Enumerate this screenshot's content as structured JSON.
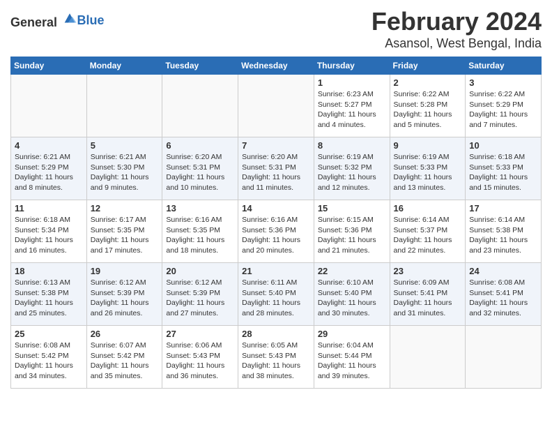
{
  "logo": {
    "general": "General",
    "blue": "Blue"
  },
  "title": "February 2024",
  "subtitle": "Asansol, West Bengal, India",
  "weekdays": [
    "Sunday",
    "Monday",
    "Tuesday",
    "Wednesday",
    "Thursday",
    "Friday",
    "Saturday"
  ],
  "weeks": [
    [
      {
        "day": "",
        "sunrise": "",
        "sunset": "",
        "daylight": ""
      },
      {
        "day": "",
        "sunrise": "",
        "sunset": "",
        "daylight": ""
      },
      {
        "day": "",
        "sunrise": "",
        "sunset": "",
        "daylight": ""
      },
      {
        "day": "",
        "sunrise": "",
        "sunset": "",
        "daylight": ""
      },
      {
        "day": "1",
        "sunrise": "Sunrise: 6:23 AM",
        "sunset": "Sunset: 5:27 PM",
        "daylight": "Daylight: 11 hours and 4 minutes."
      },
      {
        "day": "2",
        "sunrise": "Sunrise: 6:22 AM",
        "sunset": "Sunset: 5:28 PM",
        "daylight": "Daylight: 11 hours and 5 minutes."
      },
      {
        "day": "3",
        "sunrise": "Sunrise: 6:22 AM",
        "sunset": "Sunset: 5:29 PM",
        "daylight": "Daylight: 11 hours and 7 minutes."
      }
    ],
    [
      {
        "day": "4",
        "sunrise": "Sunrise: 6:21 AM",
        "sunset": "Sunset: 5:29 PM",
        "daylight": "Daylight: 11 hours and 8 minutes."
      },
      {
        "day": "5",
        "sunrise": "Sunrise: 6:21 AM",
        "sunset": "Sunset: 5:30 PM",
        "daylight": "Daylight: 11 hours and 9 minutes."
      },
      {
        "day": "6",
        "sunrise": "Sunrise: 6:20 AM",
        "sunset": "Sunset: 5:31 PM",
        "daylight": "Daylight: 11 hours and 10 minutes."
      },
      {
        "day": "7",
        "sunrise": "Sunrise: 6:20 AM",
        "sunset": "Sunset: 5:31 PM",
        "daylight": "Daylight: 11 hours and 11 minutes."
      },
      {
        "day": "8",
        "sunrise": "Sunrise: 6:19 AM",
        "sunset": "Sunset: 5:32 PM",
        "daylight": "Daylight: 11 hours and 12 minutes."
      },
      {
        "day": "9",
        "sunrise": "Sunrise: 6:19 AM",
        "sunset": "Sunset: 5:33 PM",
        "daylight": "Daylight: 11 hours and 13 minutes."
      },
      {
        "day": "10",
        "sunrise": "Sunrise: 6:18 AM",
        "sunset": "Sunset: 5:33 PM",
        "daylight": "Daylight: 11 hours and 15 minutes."
      }
    ],
    [
      {
        "day": "11",
        "sunrise": "Sunrise: 6:18 AM",
        "sunset": "Sunset: 5:34 PM",
        "daylight": "Daylight: 11 hours and 16 minutes."
      },
      {
        "day": "12",
        "sunrise": "Sunrise: 6:17 AM",
        "sunset": "Sunset: 5:35 PM",
        "daylight": "Daylight: 11 hours and 17 minutes."
      },
      {
        "day": "13",
        "sunrise": "Sunrise: 6:16 AM",
        "sunset": "Sunset: 5:35 PM",
        "daylight": "Daylight: 11 hours and 18 minutes."
      },
      {
        "day": "14",
        "sunrise": "Sunrise: 6:16 AM",
        "sunset": "Sunset: 5:36 PM",
        "daylight": "Daylight: 11 hours and 20 minutes."
      },
      {
        "day": "15",
        "sunrise": "Sunrise: 6:15 AM",
        "sunset": "Sunset: 5:36 PM",
        "daylight": "Daylight: 11 hours and 21 minutes."
      },
      {
        "day": "16",
        "sunrise": "Sunrise: 6:14 AM",
        "sunset": "Sunset: 5:37 PM",
        "daylight": "Daylight: 11 hours and 22 minutes."
      },
      {
        "day": "17",
        "sunrise": "Sunrise: 6:14 AM",
        "sunset": "Sunset: 5:38 PM",
        "daylight": "Daylight: 11 hours and 23 minutes."
      }
    ],
    [
      {
        "day": "18",
        "sunrise": "Sunrise: 6:13 AM",
        "sunset": "Sunset: 5:38 PM",
        "daylight": "Daylight: 11 hours and 25 minutes."
      },
      {
        "day": "19",
        "sunrise": "Sunrise: 6:12 AM",
        "sunset": "Sunset: 5:39 PM",
        "daylight": "Daylight: 11 hours and 26 minutes."
      },
      {
        "day": "20",
        "sunrise": "Sunrise: 6:12 AM",
        "sunset": "Sunset: 5:39 PM",
        "daylight": "Daylight: 11 hours and 27 minutes."
      },
      {
        "day": "21",
        "sunrise": "Sunrise: 6:11 AM",
        "sunset": "Sunset: 5:40 PM",
        "daylight": "Daylight: 11 hours and 28 minutes."
      },
      {
        "day": "22",
        "sunrise": "Sunrise: 6:10 AM",
        "sunset": "Sunset: 5:40 PM",
        "daylight": "Daylight: 11 hours and 30 minutes."
      },
      {
        "day": "23",
        "sunrise": "Sunrise: 6:09 AM",
        "sunset": "Sunset: 5:41 PM",
        "daylight": "Daylight: 11 hours and 31 minutes."
      },
      {
        "day": "24",
        "sunrise": "Sunrise: 6:08 AM",
        "sunset": "Sunset: 5:41 PM",
        "daylight": "Daylight: 11 hours and 32 minutes."
      }
    ],
    [
      {
        "day": "25",
        "sunrise": "Sunrise: 6:08 AM",
        "sunset": "Sunset: 5:42 PM",
        "daylight": "Daylight: 11 hours and 34 minutes."
      },
      {
        "day": "26",
        "sunrise": "Sunrise: 6:07 AM",
        "sunset": "Sunset: 5:42 PM",
        "daylight": "Daylight: 11 hours and 35 minutes."
      },
      {
        "day": "27",
        "sunrise": "Sunrise: 6:06 AM",
        "sunset": "Sunset: 5:43 PM",
        "daylight": "Daylight: 11 hours and 36 minutes."
      },
      {
        "day": "28",
        "sunrise": "Sunrise: 6:05 AM",
        "sunset": "Sunset: 5:43 PM",
        "daylight": "Daylight: 11 hours and 38 minutes."
      },
      {
        "day": "29",
        "sunrise": "Sunrise: 6:04 AM",
        "sunset": "Sunset: 5:44 PM",
        "daylight": "Daylight: 11 hours and 39 minutes."
      },
      {
        "day": "",
        "sunrise": "",
        "sunset": "",
        "daylight": ""
      },
      {
        "day": "",
        "sunrise": "",
        "sunset": "",
        "daylight": ""
      }
    ]
  ]
}
